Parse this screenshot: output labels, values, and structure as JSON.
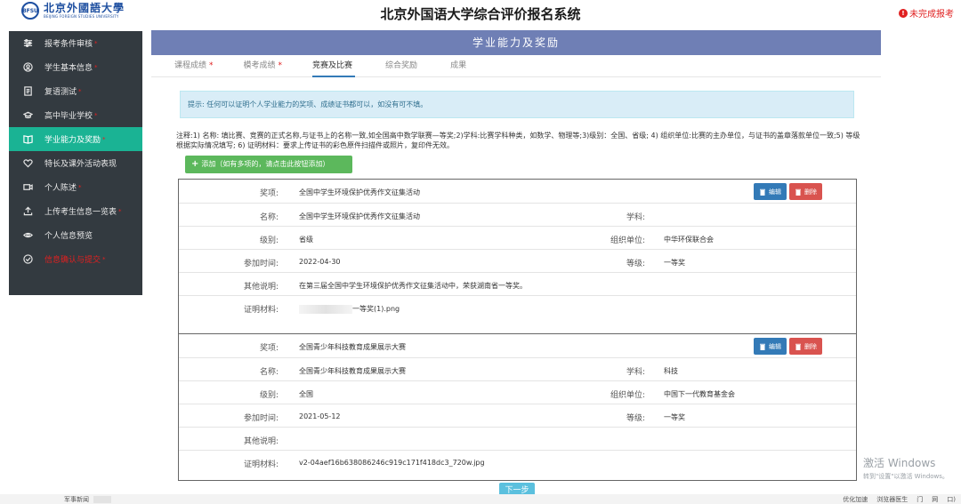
{
  "header": {
    "logo_cn": "北京外國語大學",
    "logo_en": "BEIJING FOREIGN STUDIES UNIVERSITY",
    "logo_seal": "BFSU",
    "title": "北京外国语大学综合评价报名系统",
    "status": "未完成报考",
    "status_icon_glyph": "!"
  },
  "sidebar": {
    "items": [
      {
        "label": "报考条件审核",
        "icon": "sliders-icon",
        "required": "*"
      },
      {
        "label": "学生基本信息",
        "icon": "user-icon",
        "required": "*"
      },
      {
        "label": "复语测试",
        "icon": "document-icon",
        "required": "*"
      },
      {
        "label": "高中毕业学校",
        "icon": "graduation-cap-icon",
        "required": "*"
      },
      {
        "label": "学业能力及奖励",
        "icon": "book-icon",
        "required": "*"
      },
      {
        "label": "特长及课外活动表现",
        "icon": "heart-icon",
        "required": ""
      },
      {
        "label": "个人陈述",
        "icon": "video-icon",
        "required": "*"
      },
      {
        "label": "上传考生信息一览表",
        "icon": "upload-icon",
        "required": "*"
      },
      {
        "label": "个人信息预览",
        "icon": "eye-icon",
        "required": ""
      },
      {
        "label": "信息确认与提交",
        "icon": "check-circle-icon",
        "required": "*"
      }
    ]
  },
  "main": {
    "banner": "学业能力及奖励",
    "tabs": [
      {
        "label": "课程成绩",
        "required": "*"
      },
      {
        "label": "模考成绩",
        "required": "*"
      },
      {
        "label": "竞赛及比赛",
        "required": ""
      },
      {
        "label": "综合奖励",
        "required": ""
      },
      {
        "label": "成果",
        "required": ""
      }
    ],
    "hint": "提示: 任何可以证明个人学业能力的奖项、成绩证书都可以，如没有可不填。",
    "note": "注释:1) 名称: 填比赛、竞赛的正式名称,与证书上的名称一致,如全国高中数学联赛—等奖;2)学科:比赛学科种类，如数学、物理等;3)级别：全国、省级; 4) 组织单位:比赛的主办单位，与证书的盖章落款单位一致;5) 等级根据实际情况填写; 6) 证明材料：要求上传证书的彩色原件扫描件或照片，复印件无效。",
    "add_button": "添加（如有多项的，请点击此按钮添加）",
    "add_icon_glyph": "+",
    "labels": {
      "award": "奖项:",
      "name": "名称:",
      "subject": "学科:",
      "level": "级别:",
      "org": "组织单位:",
      "time": "参加时间:",
      "grade": "等级:",
      "other": "其他说明:",
      "proof": "证明材料:"
    },
    "edit_button": "编辑",
    "delete_button": "删除",
    "records": [
      {
        "award": "全国中学生环境保护优秀作文征集活动",
        "name": "全国中学生环境保护优秀作文征集活动",
        "subject": "",
        "level": "省级",
        "org": "中华环保联合会",
        "time": "2022-04-30",
        "grade": "一等奖",
        "other": "在第三届全国中学生环境保护优秀作文征集活动中，荣获湖南省一等奖。",
        "proof": "一等奖(1).png"
      },
      {
        "award": "全国青少年科技教育成果展示大赛",
        "name": "全国青少年科技教育成果展示大赛",
        "subject": "科技",
        "level": "全国",
        "org": "中国下一代教育基金会",
        "time": "2021-05-12",
        "grade": "一等奖",
        "other": "",
        "proof": "v2-04aef16b638086246c919c171f418dc3_720w.jpg"
      }
    ],
    "next_button": "下一步"
  },
  "watermark": {
    "line1": "激活 Windows",
    "line2": "转到\"设置\"以激活 Windows。"
  },
  "taskbar": {
    "left": "军事新闻",
    "right": [
      "优化加速",
      "浏览器医生",
      "门",
      "网",
      "口)"
    ]
  }
}
